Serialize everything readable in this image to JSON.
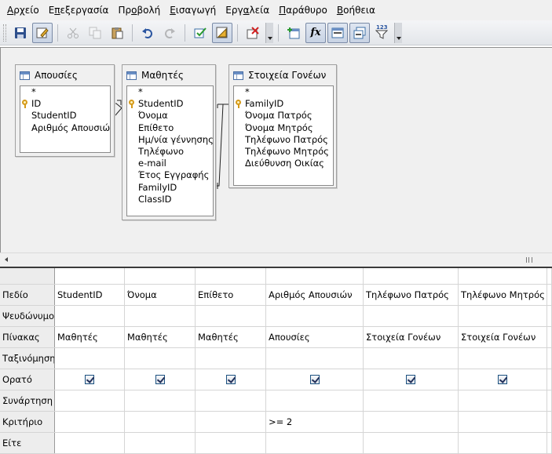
{
  "menu": [
    {
      "label": "Αρχείο",
      "mnemonic_index": 0
    },
    {
      "label": "Επεξεργασία",
      "mnemonic_index": 1
    },
    {
      "label": "Προβολή",
      "mnemonic_index": 2
    },
    {
      "label": "Εισαγωγή",
      "mnemonic_index": 0
    },
    {
      "label": "Εργαλεία",
      "mnemonic_index": 3
    },
    {
      "label": "Παράθυρο",
      "mnemonic_index": 0
    },
    {
      "label": "Βοήθεια",
      "mnemonic_index": 0
    }
  ],
  "toolbar": {
    "icons": [
      "save-icon",
      "edit-mode-icon",
      "cut-icon",
      "copy-icon",
      "paste-icon",
      "undo-icon",
      "redo-icon",
      "run-query-icon",
      "design-view-icon",
      "clear-query-icon",
      "add-tables-icon",
      "functions-icon",
      "table-name-icon",
      "alias-icon",
      "distinct-values-icon"
    ],
    "functions_label": "fx",
    "distinct_label": "123"
  },
  "tables": [
    {
      "title": "Απουσίες",
      "fields": [
        {
          "name": "*",
          "key": false
        },
        {
          "name": "ID",
          "key": true
        },
        {
          "name": "StudentID",
          "key": false
        },
        {
          "name": "Αριθμός Απουσιών",
          "key": false
        }
      ]
    },
    {
      "title": "Μαθητές",
      "fields": [
        {
          "name": "*",
          "key": false
        },
        {
          "name": "StudentID",
          "key": true
        },
        {
          "name": "Όνομα",
          "key": false
        },
        {
          "name": "Επίθετο",
          "key": false
        },
        {
          "name": "Ημ/νία γέννησης",
          "key": false
        },
        {
          "name": "Τηλέφωνο",
          "key": false
        },
        {
          "name": "e-mail",
          "key": false
        },
        {
          "name": "Έτος Εγγραφής",
          "key": false
        },
        {
          "name": "FamilyID",
          "key": false
        },
        {
          "name": "ClassID",
          "key": false
        }
      ]
    },
    {
      "title": "Στοιχεία Γονέων",
      "fields": [
        {
          "name": "*",
          "key": false
        },
        {
          "name": "FamilyID",
          "key": true
        },
        {
          "name": "Όνομα Πατρός",
          "key": false
        },
        {
          "name": "Όνομα Μητρός",
          "key": false
        },
        {
          "name": "Τηλέφωνο Πατρός",
          "key": false
        },
        {
          "name": "Τηλέφωνο Μητρός",
          "key": false
        },
        {
          "name": "Διεύθυνση Οικίας",
          "key": false
        }
      ]
    }
  ],
  "grid": {
    "row_labels": [
      "Πεδίο",
      "Ψευδώνυμο",
      "Πίνακας",
      "Ταξινόμηση",
      "Ορατό",
      "Συνάρτηση",
      "Κριτήριο",
      "Είτε"
    ],
    "columns": [
      {
        "field": "StudentID",
        "alias": "",
        "table": "Μαθητές",
        "sort": "",
        "visible": true,
        "function": "",
        "criterion": "",
        "or": ""
      },
      {
        "field": "Όνομα",
        "alias": "",
        "table": "Μαθητές",
        "sort": "",
        "visible": true,
        "function": "",
        "criterion": "",
        "or": ""
      },
      {
        "field": "Επίθετο",
        "alias": "",
        "table": "Μαθητές",
        "sort": "",
        "visible": true,
        "function": "",
        "criterion": "",
        "or": ""
      },
      {
        "field": "Αριθμός Απουσιών",
        "alias": "",
        "table": "Απουσίες",
        "sort": "",
        "visible": true,
        "function": "",
        "criterion": ">= 2",
        "or": ""
      },
      {
        "field": "Τηλέφωνο Πατρός",
        "alias": "",
        "table": "Στοιχεία Γονέων",
        "sort": "",
        "visible": true,
        "function": "",
        "criterion": "",
        "or": ""
      },
      {
        "field": "Τηλέφωνο Μητρός",
        "alias": "",
        "table": "Στοιχεία Γονέων",
        "sort": "",
        "visible": true,
        "function": "",
        "criterion": "",
        "or": ""
      }
    ]
  }
}
